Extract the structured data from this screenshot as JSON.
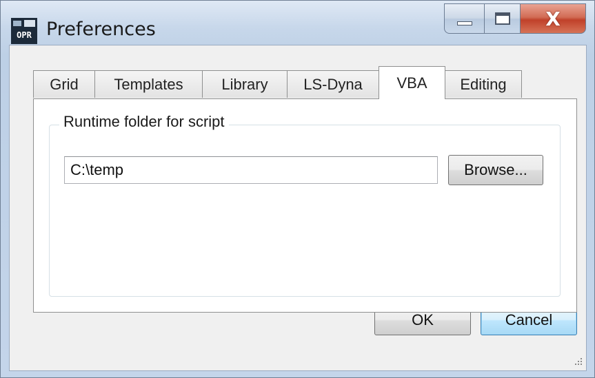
{
  "window": {
    "title": "Preferences",
    "app_icon": "opr-app-icon",
    "caption_buttons": {
      "minimize": "minimize-icon",
      "maximize": "maximize-icon",
      "close": "X"
    }
  },
  "tabs": [
    {
      "label": "Grid",
      "active": false
    },
    {
      "label": "Templates",
      "active": false
    },
    {
      "label": "Library",
      "active": false
    },
    {
      "label": "LS-Dyna",
      "active": false
    },
    {
      "label": "VBA",
      "active": true
    },
    {
      "label": "Editing",
      "active": false
    }
  ],
  "vba_panel": {
    "group_label": "Runtime folder for script",
    "folder_value": "C:\\temp",
    "browse_label": "Browse..."
  },
  "footer": {
    "ok_label": "OK",
    "cancel_label": "Cancel"
  },
  "colors": {
    "title_bar": "#c7d7ea",
    "close_button": "#c0412a",
    "default_button_border": "#3c7fb1"
  }
}
